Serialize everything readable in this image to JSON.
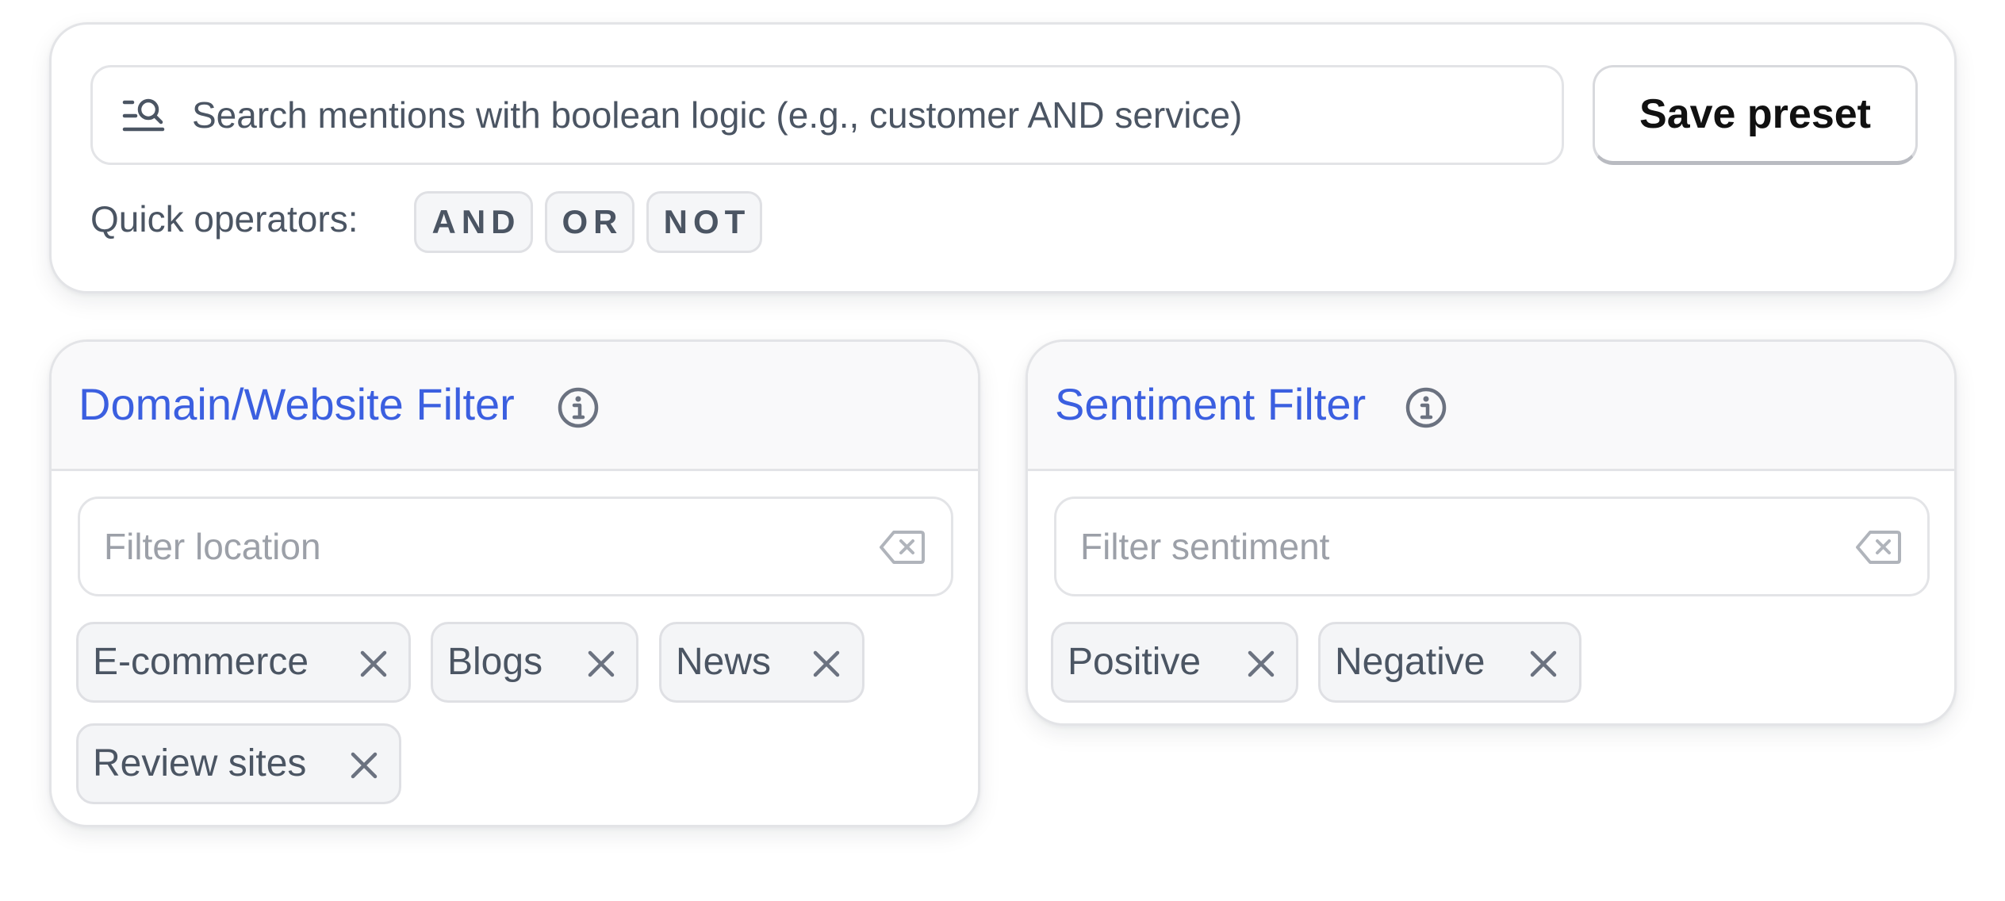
{
  "search": {
    "placeholder": "Search mentions with boolean logic (e.g., customer AND service)",
    "value": "",
    "icon": "search-filter-icon",
    "save_label": "Save preset",
    "operators_label": "Quick operators:",
    "operators": [
      "AND",
      "OR",
      "NOT"
    ]
  },
  "domain_filter": {
    "title": "Domain/Website Filter",
    "info_icon": "info-icon",
    "input_placeholder": "Filter location",
    "clear_icon": "backspace-clear-icon",
    "tags": [
      "E-commerce",
      "Blogs",
      "News",
      "Review sites"
    ]
  },
  "sentiment_filter": {
    "title": "Sentiment Filter",
    "info_icon": "info-icon",
    "input_placeholder": "Filter sentiment",
    "clear_icon": "backspace-clear-icon",
    "tags": [
      "Positive",
      "Negative"
    ]
  },
  "colors": {
    "accent": "#3b5fe0",
    "text": "#4b5563",
    "border": "#e3e4e7",
    "chip_bg": "#f4f5f7"
  }
}
